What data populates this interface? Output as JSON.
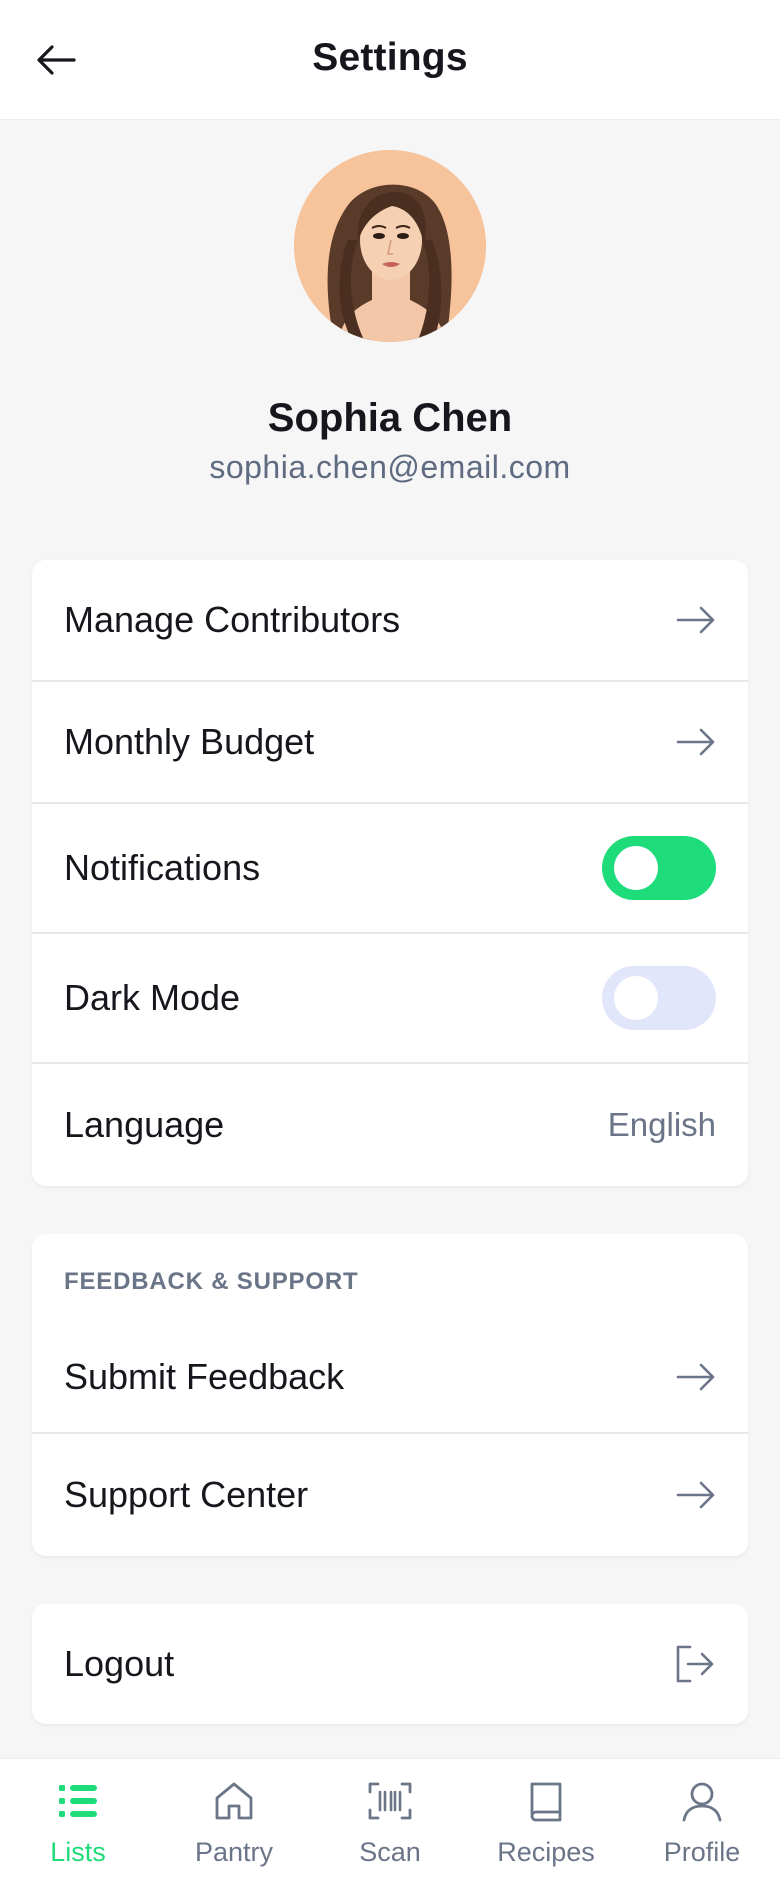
{
  "header": {
    "title": "Settings",
    "back_icon": "arrow-left-icon"
  },
  "profile": {
    "name": "Sophia Chen",
    "email": "sophia.chen@email.com",
    "avatar": "illustrated-woman-avatar"
  },
  "settings": {
    "items": [
      {
        "label": "Manage Contributors",
        "control": "arrow"
      },
      {
        "label": "Monthly Budget",
        "control": "arrow"
      },
      {
        "label": "Notifications",
        "control": "toggle",
        "enabled": true
      },
      {
        "label": "Dark Mode",
        "control": "toggle",
        "enabled": false
      },
      {
        "label": "Language",
        "control": "value",
        "value": "English"
      }
    ]
  },
  "support": {
    "section_title": "FEEDBACK & SUPPORT",
    "items": [
      {
        "label": "Submit Feedback"
      },
      {
        "label": "Support Center"
      }
    ]
  },
  "logout": {
    "label": "Logout",
    "icon": "logout-icon"
  },
  "bottom_nav": {
    "items": [
      {
        "label": "Lists",
        "icon": "list-icon",
        "active": true
      },
      {
        "label": "Pantry",
        "icon": "home-icon",
        "active": false
      },
      {
        "label": "Scan",
        "icon": "barcode-scan-icon",
        "active": false
      },
      {
        "label": "Recipes",
        "icon": "book-icon",
        "active": false
      },
      {
        "label": "Profile",
        "icon": "user-icon",
        "active": false
      }
    ]
  },
  "colors": {
    "accent": "#1fdc7a",
    "toggle_off": "#e2e6fa",
    "muted_text": "#6b7588",
    "background": "#f6f6f7"
  }
}
